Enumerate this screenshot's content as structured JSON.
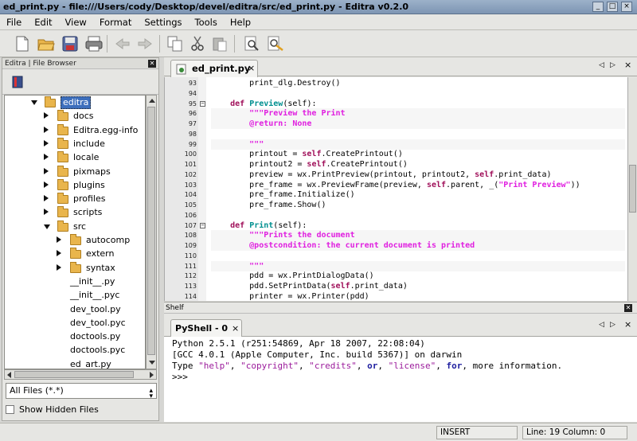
{
  "window": {
    "title": "ed_print.py - file:///Users/cody/Desktop/devel/editra/src/ed_print.py - Editra v0.2.0"
  },
  "menu": [
    "File",
    "Edit",
    "View",
    "Format",
    "Settings",
    "Tools",
    "Help"
  ],
  "sidebar": {
    "title": "Editra | File Browser",
    "tree": [
      {
        "label": "editra",
        "depth": 0,
        "expanded": true,
        "folder": true,
        "selected": true
      },
      {
        "label": "docs",
        "depth": 1,
        "expanded": false,
        "folder": true
      },
      {
        "label": "Editra.egg-info",
        "depth": 1,
        "expanded": false,
        "folder": true
      },
      {
        "label": "include",
        "depth": 1,
        "expanded": false,
        "folder": true
      },
      {
        "label": "locale",
        "depth": 1,
        "expanded": false,
        "folder": true
      },
      {
        "label": "pixmaps",
        "depth": 1,
        "expanded": false,
        "folder": true
      },
      {
        "label": "plugins",
        "depth": 1,
        "expanded": false,
        "folder": true
      },
      {
        "label": "profiles",
        "depth": 1,
        "expanded": false,
        "folder": true
      },
      {
        "label": "scripts",
        "depth": 1,
        "expanded": false,
        "folder": true
      },
      {
        "label": "src",
        "depth": 1,
        "expanded": true,
        "folder": true
      },
      {
        "label": "autocomp",
        "depth": 2,
        "expanded": false,
        "folder": true
      },
      {
        "label": "extern",
        "depth": 2,
        "expanded": false,
        "folder": true
      },
      {
        "label": "syntax",
        "depth": 2,
        "expanded": false,
        "folder": true
      },
      {
        "label": "__init__.py",
        "depth": 2,
        "folder": false
      },
      {
        "label": "__init__.pyc",
        "depth": 2,
        "folder": false
      },
      {
        "label": "dev_tool.py",
        "depth": 2,
        "folder": false
      },
      {
        "label": "dev_tool.pyc",
        "depth": 2,
        "folder": false
      },
      {
        "label": "doctools.py",
        "depth": 2,
        "folder": false
      },
      {
        "label": "doctools.pyc",
        "depth": 2,
        "folder": false
      },
      {
        "label": "ed_art.py",
        "depth": 2,
        "folder": false
      }
    ],
    "filter_value": "All Files (*.*)",
    "show_hidden_label": "Show Hidden Files"
  },
  "editor": {
    "tab_label": "ed_print.py",
    "lines": [
      {
        "n": "93",
        "code": [
          [
            "",
            "        print_dlg.Destroy()"
          ]
        ]
      },
      {
        "n": "94",
        "code": [
          [
            "",
            ""
          ]
        ]
      },
      {
        "n": "95",
        "fold": true,
        "code": [
          [
            "",
            "    "
          ],
          [
            "kw",
            "def "
          ],
          [
            "fn",
            "Preview"
          ],
          [
            "",
            "(self):"
          ]
        ]
      },
      {
        "n": "96",
        "hl": true,
        "code": [
          [
            "ds",
            "        \"\"\"Preview the Print"
          ]
        ]
      },
      {
        "n": "97",
        "hl": true,
        "code": [
          [
            "ds",
            "        @return: None"
          ]
        ]
      },
      {
        "n": "98",
        "hl": true,
        "code": [
          [
            "",
            ""
          ]
        ]
      },
      {
        "n": "99",
        "hl": true,
        "code": [
          [
            "ds",
            "        \"\"\""
          ]
        ]
      },
      {
        "n": "100",
        "code": [
          [
            "",
            "        printout = "
          ],
          [
            "kw",
            "self"
          ],
          [
            "",
            ".CreatePrintout()"
          ]
        ]
      },
      {
        "n": "101",
        "code": [
          [
            "",
            "        printout2 = "
          ],
          [
            "kw",
            "self"
          ],
          [
            "",
            ".CreatePrintout()"
          ]
        ]
      },
      {
        "n": "102",
        "code": [
          [
            "",
            "        preview = wx.PrintPreview(printout, printout2, "
          ],
          [
            "kw",
            "self"
          ],
          [
            "",
            ".print_data)"
          ]
        ]
      },
      {
        "n": "103",
        "code": [
          [
            "",
            "        pre_frame = wx.PreviewFrame(preview, "
          ],
          [
            "kw",
            "self"
          ],
          [
            "",
            ".parent, _("
          ],
          [
            "str",
            "\"Print Preview\""
          ],
          [
            "",
            "))"
          ]
        ]
      },
      {
        "n": "104",
        "code": [
          [
            "",
            "        pre_frame.Initialize()"
          ]
        ]
      },
      {
        "n": "105",
        "code": [
          [
            "",
            "        pre_frame.Show()"
          ]
        ]
      },
      {
        "n": "106",
        "code": [
          [
            "",
            ""
          ]
        ]
      },
      {
        "n": "107",
        "fold": true,
        "code": [
          [
            "",
            "    "
          ],
          [
            "kw",
            "def "
          ],
          [
            "fn",
            "Print"
          ],
          [
            "",
            "(self):"
          ]
        ]
      },
      {
        "n": "108",
        "hl": true,
        "code": [
          [
            "ds",
            "        \"\"\"Prints the document"
          ]
        ]
      },
      {
        "n": "109",
        "hl": true,
        "code": [
          [
            "ds",
            "        @postcondition: the current document is printed"
          ]
        ]
      },
      {
        "n": "110",
        "hl": true,
        "code": [
          [
            "",
            ""
          ]
        ]
      },
      {
        "n": "111",
        "hl": true,
        "code": [
          [
            "ds",
            "        \"\"\""
          ]
        ]
      },
      {
        "n": "112",
        "code": [
          [
            "",
            "        pdd = wx.PrintDialogData()"
          ]
        ]
      },
      {
        "n": "113",
        "code": [
          [
            "",
            "        pdd.SetPrintData("
          ],
          [
            "kw",
            "self"
          ],
          [
            "",
            ".print_data)"
          ]
        ]
      },
      {
        "n": "114",
        "code": [
          [
            "",
            "        printer = wx.Printer(pdd)"
          ]
        ]
      }
    ]
  },
  "shelf": {
    "title": "Shelf",
    "tab_label": "PyShell - 0",
    "lines": [
      [
        [
          "",
          "Python 2.5.1 (r251:54869, Apr 18 2007, 22:08:04)"
        ]
      ],
      [
        [
          "",
          "[GCC 4.0.1 (Apple Computer, Inc. build 5367)] on darwin"
        ]
      ],
      [
        [
          "",
          "Type "
        ],
        [
          "ss",
          "\"help\""
        ],
        [
          "",
          ", "
        ],
        [
          "ss",
          "\"copyright\""
        ],
        [
          "",
          ", "
        ],
        [
          "ss",
          "\"credits\""
        ],
        [
          "",
          ", "
        ],
        [
          "sk",
          "or"
        ],
        [
          "",
          ", "
        ],
        [
          "ss",
          "\"license\""
        ],
        [
          "",
          ", "
        ],
        [
          "sk",
          "for"
        ],
        [
          "",
          ", more information."
        ]
      ],
      [
        [
          "",
          ">>>"
        ]
      ]
    ]
  },
  "status": {
    "mode": "INSERT",
    "position": "Line: 19  Column: 0"
  },
  "colors": {
    "keyword": "#a0105a",
    "function": "#009090",
    "string": "#e01fe0"
  }
}
